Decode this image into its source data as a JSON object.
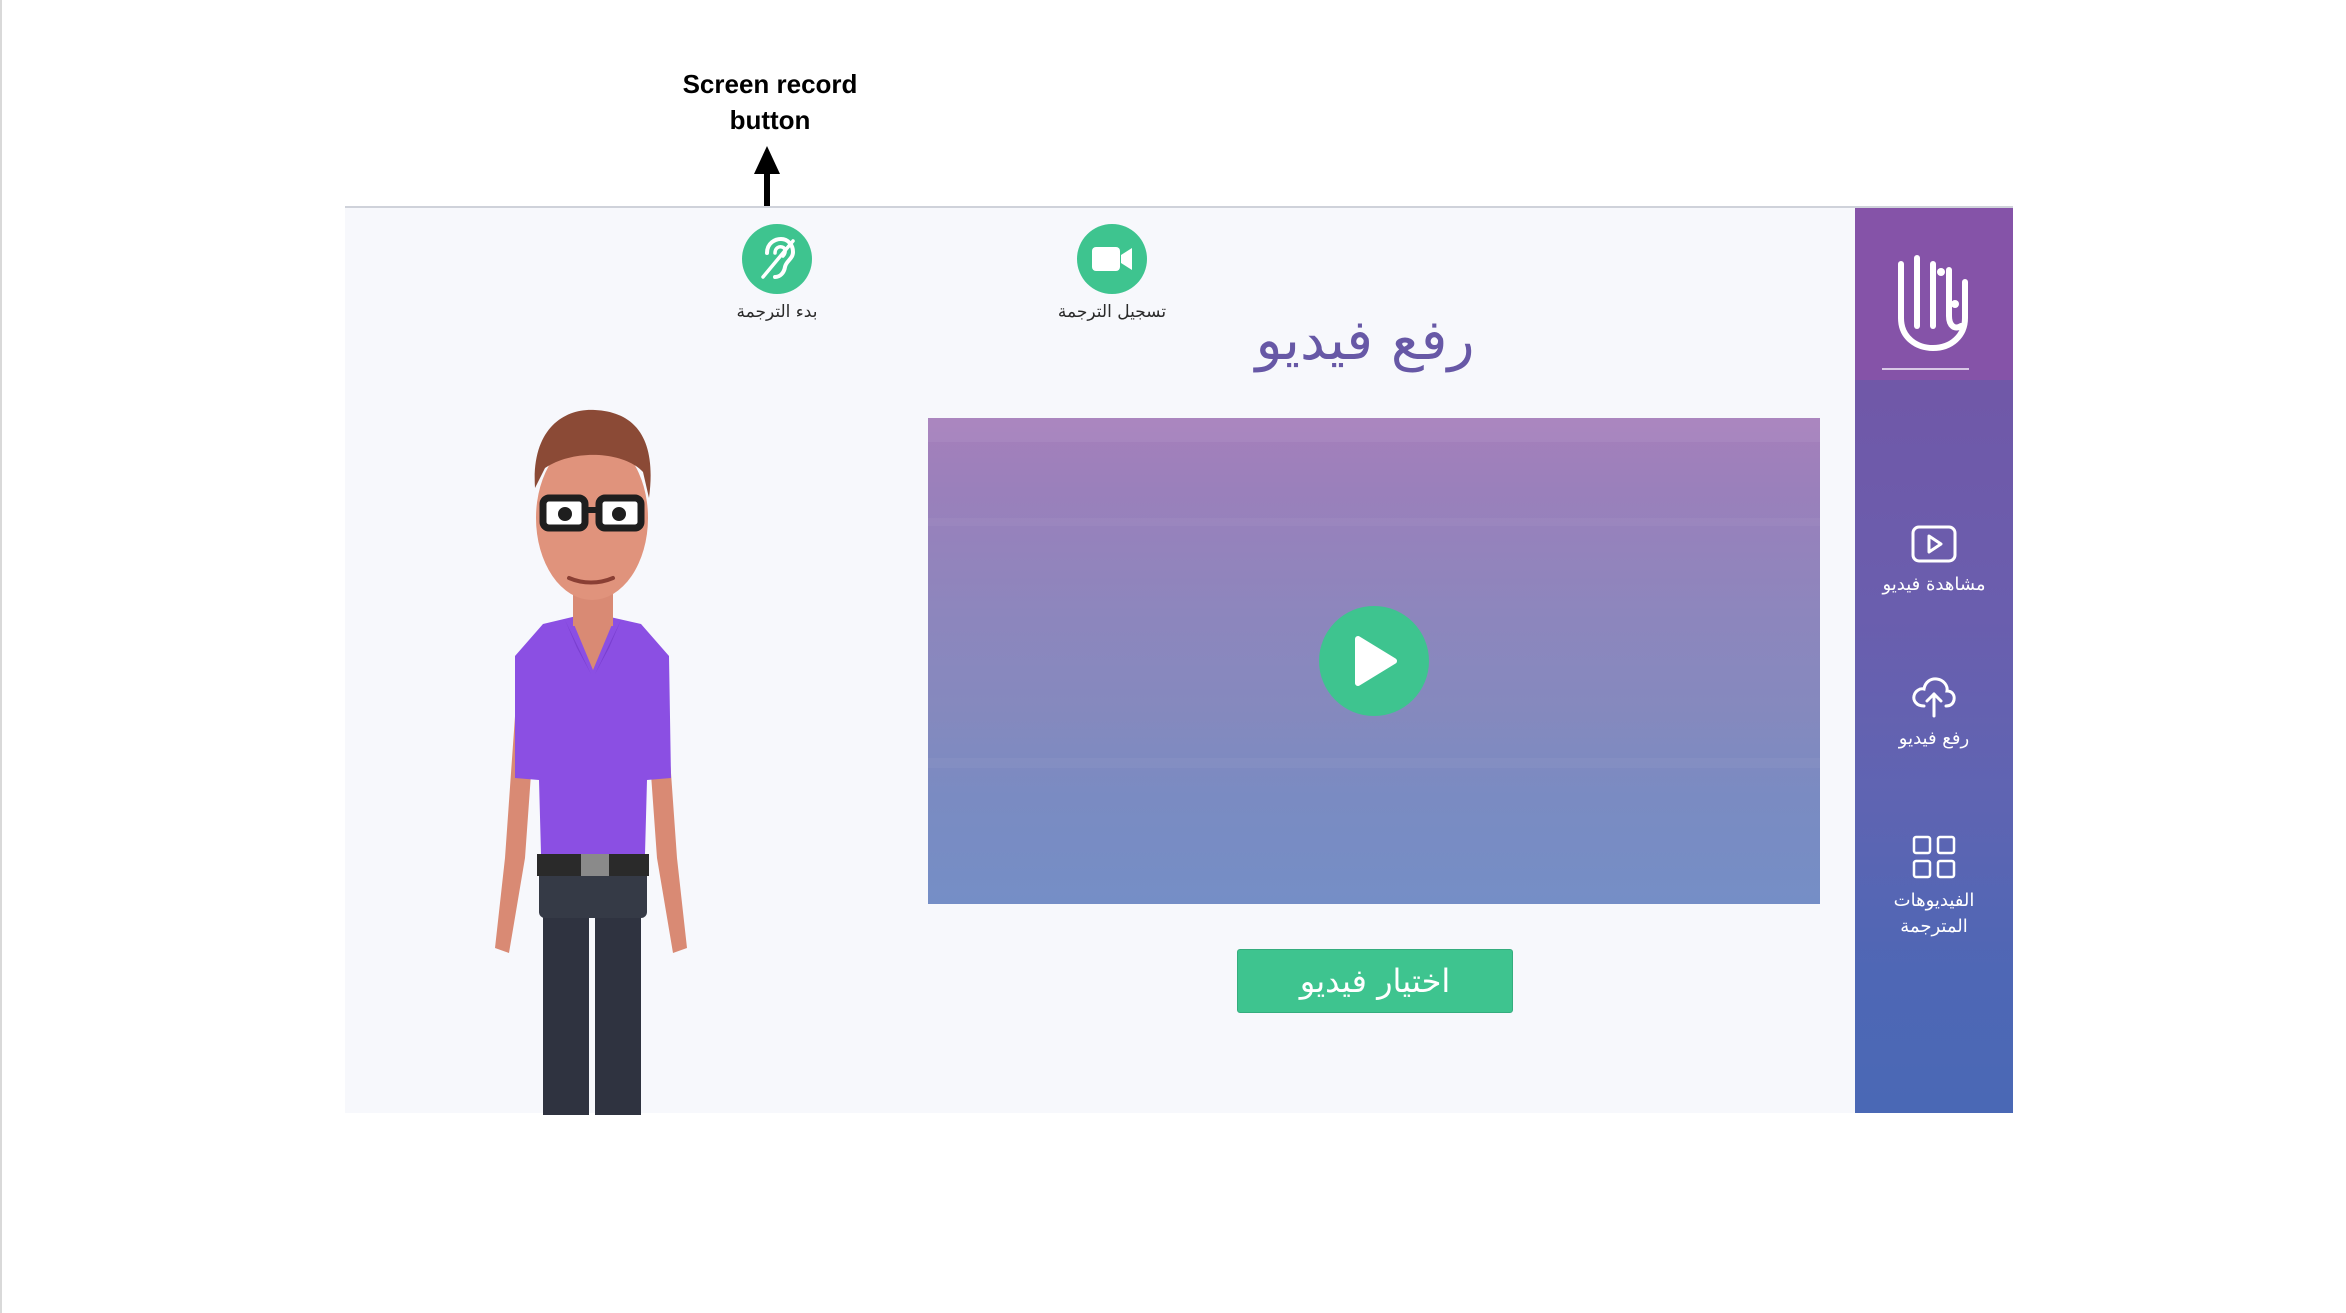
{
  "annotation": {
    "line1": "Screen record",
    "line2": "button"
  },
  "toolbar": {
    "start_subtitle_label": "بدء الترجمة",
    "record_label": "تسجيل الترجمة"
  },
  "main": {
    "title": "رفع فيديو",
    "choose_button_label": "اختيار فيديو"
  },
  "sidebar": {
    "items": [
      {
        "label": "مشاهدة فيديو",
        "icon": "play-video-icon"
      },
      {
        "label": "رفع فيديو",
        "icon": "cloud-upload-icon"
      },
      {
        "label_line1": "الفيديوهات",
        "label_line2": "المترجمة",
        "icon": "grid-icon"
      }
    ]
  },
  "colors": {
    "accent_green": "#3ec48f",
    "title_purple": "#6758a6",
    "sidebar_top": "#8553a8",
    "sidebar_bottom": "#4a68b5"
  }
}
